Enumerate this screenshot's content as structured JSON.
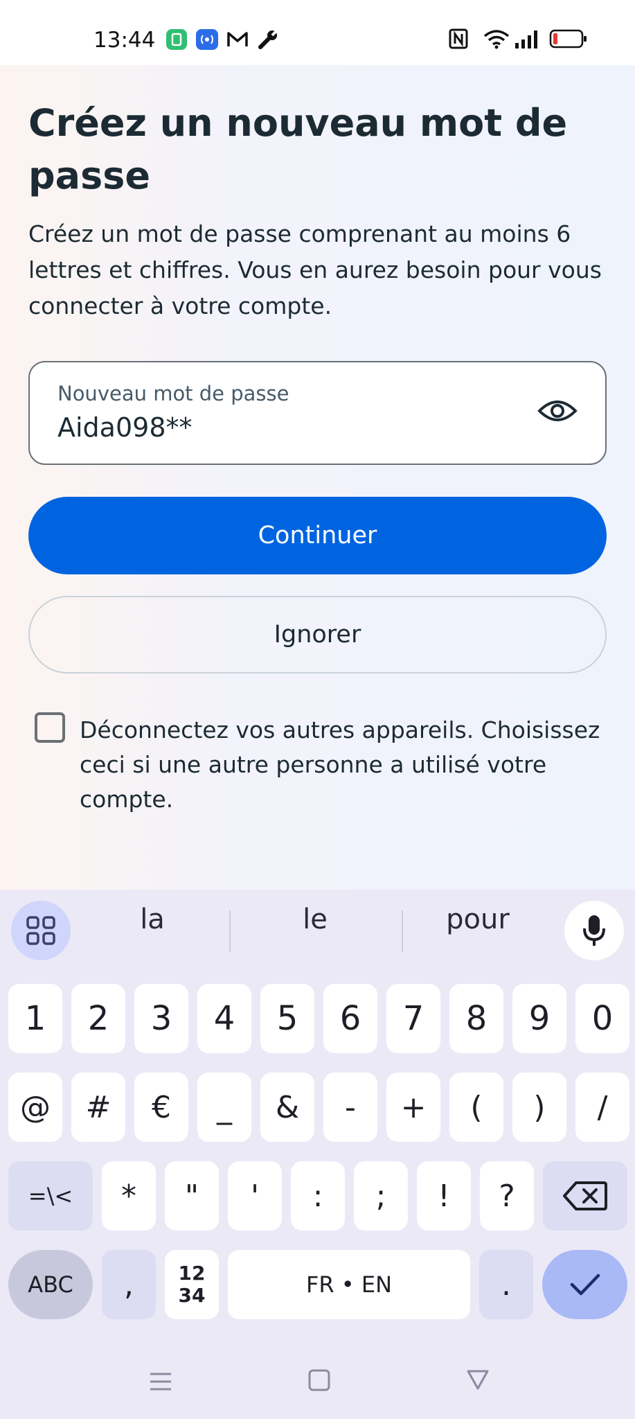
{
  "status_bar": {
    "time": "13:44",
    "left_icons": [
      "green-app-icon",
      "blue-broadcast-icon",
      "gmail-icon",
      "wrench-icon"
    ],
    "right_icons": [
      "nfc-icon",
      "wifi-icon",
      "signal-icon",
      "battery-low-icon"
    ],
    "battery_color": "#e53935"
  },
  "page": {
    "title": "Créez un nouveau mot de passe",
    "description": "Créez un mot de passe comprenant au moins 6 lettres et chiffres. Vous en aurez besoin pour vous connecter à votre compte."
  },
  "password_field": {
    "label": "Nouveau mot de passe",
    "value": "Aida098**",
    "toggle_icon": "eye-icon"
  },
  "buttons": {
    "continue_label": "Continuer",
    "ignore_label": "Ignorer"
  },
  "logout_option": {
    "checked": false,
    "text": "Déconnectez vos autres appareils. Choisissez ceci si une autre personne a utilisé votre compte."
  },
  "keyboard": {
    "suggestions": [
      "la",
      "le",
      "pour"
    ],
    "row1": [
      "1",
      "2",
      "3",
      "4",
      "5",
      "6",
      "7",
      "8",
      "9",
      "0"
    ],
    "row2": [
      "@",
      "#",
      "€",
      "_",
      "&",
      "-",
      "+",
      "(",
      ")",
      "/"
    ],
    "row3": [
      "=\\<",
      "*",
      "\"",
      "'",
      ":",
      ";",
      "!",
      "?"
    ],
    "abc_label": "ABC",
    "comma": ",",
    "numpad_label_top": "12",
    "numpad_label_bottom": "34",
    "space_label": "FR • EN",
    "period": ".",
    "accent_color": "#0064e0"
  },
  "nav_bar": {
    "icons": [
      "menu-icon",
      "home-square-icon",
      "back-triangle-icon"
    ]
  }
}
